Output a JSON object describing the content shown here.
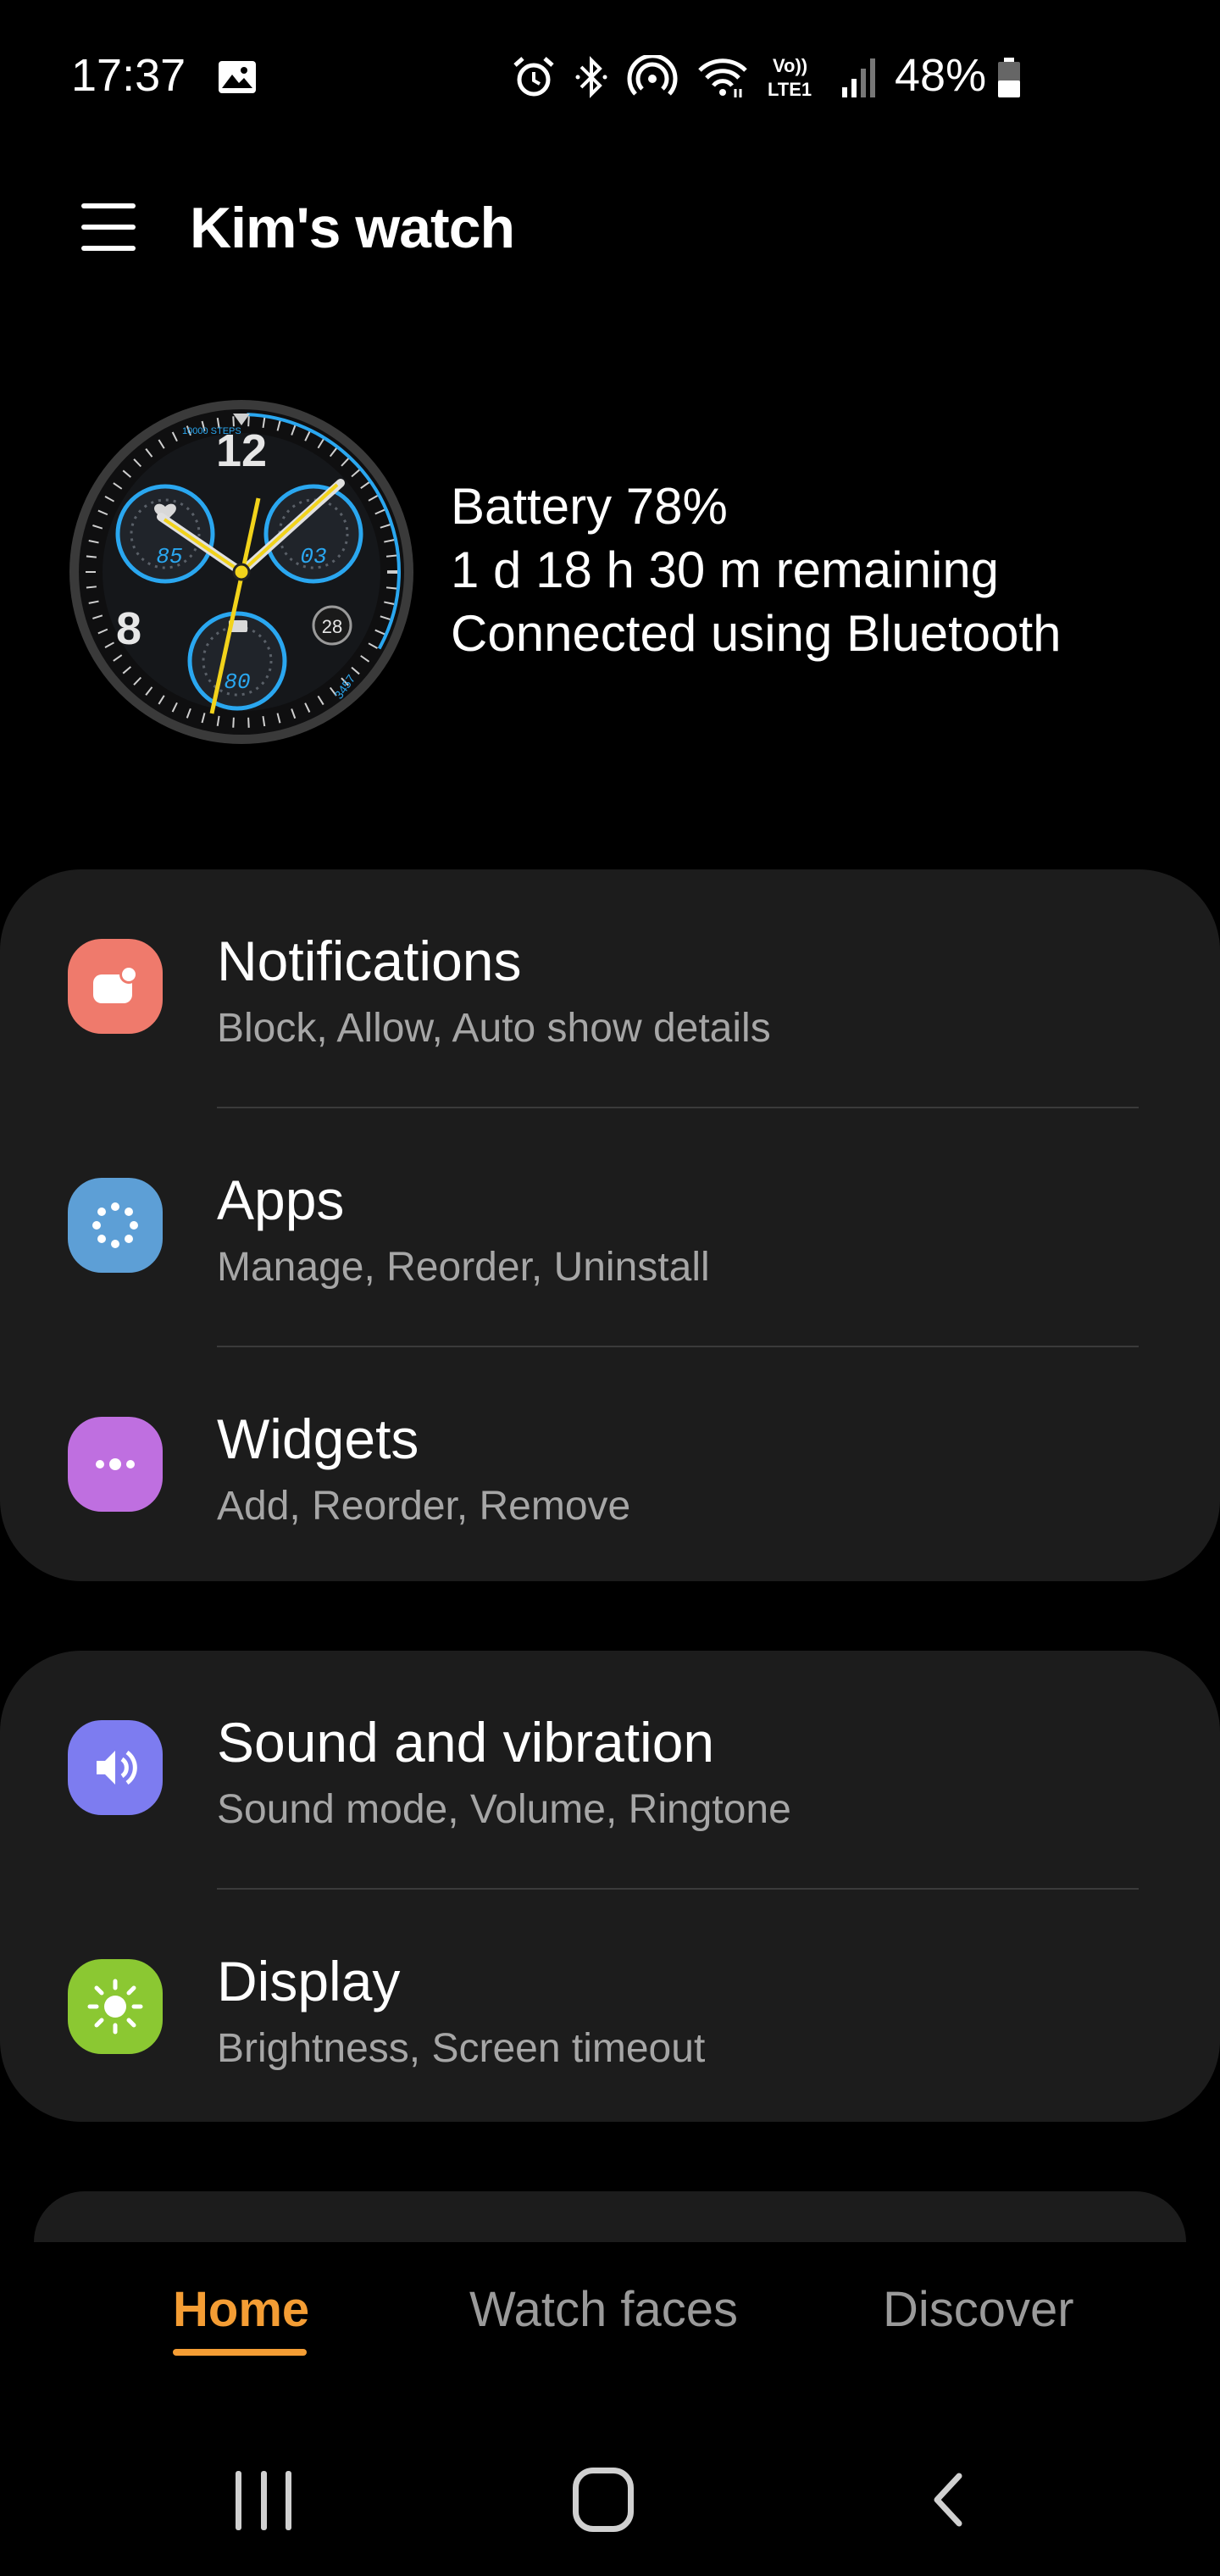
{
  "status_bar": {
    "time": "17:37",
    "battery_percent": "48%",
    "battery_level": 0.48,
    "icons": [
      "gallery-icon",
      "alarm-icon",
      "bluetooth-icon",
      "hotspot-icon",
      "wifi-icon",
      "volte-icon",
      "signal-icon",
      "battery-icon"
    ],
    "volte_label_top": "Vo))",
    "volte_label_bottom": "LTE1"
  },
  "header": {
    "title": "Kim's watch",
    "menu_icon": "hamburger-menu-icon"
  },
  "watch": {
    "face_numbers": {
      "twelve": "12",
      "eight": "8",
      "date": "28"
    },
    "face_steps_label": "10000 STEPS",
    "face_dials": {
      "left": "85",
      "right": "03",
      "bottom": "80"
    },
    "face_steps_count": "3457",
    "battery_line": "Battery 78%",
    "remaining_line": "1 d 18 h 30 m remaining",
    "connection_line": "Connected using Bluetooth"
  },
  "menu_groups": [
    {
      "items": [
        {
          "title": "Notifications",
          "subtitle": "Block, Allow, Auto show details",
          "icon": "notifications-icon",
          "color": "#ef7a6c"
        },
        {
          "title": "Apps",
          "subtitle": "Manage, Reorder, Uninstall",
          "icon": "apps-icon",
          "color": "#5d9fd6"
        },
        {
          "title": "Widgets",
          "subtitle": "Add, Reorder, Remove",
          "icon": "widgets-icon",
          "color": "#bf6fe0"
        }
      ]
    },
    {
      "items": [
        {
          "title": "Sound and vibration",
          "subtitle": "Sound mode, Volume, Ringtone",
          "icon": "sound-icon",
          "color": "#7d7cf0"
        },
        {
          "title": "Display",
          "subtitle": "Brightness, Screen timeout",
          "icon": "display-icon",
          "color": "#8bc832"
        }
      ]
    }
  ],
  "tabs": [
    {
      "label": "Home",
      "active": true
    },
    {
      "label": "Watch faces",
      "active": false
    },
    {
      "label": "Discover",
      "active": false
    }
  ],
  "colors": {
    "accent": "#f49d34",
    "card_bg": "#1c1c1c",
    "subtitle": "#a6a6a6",
    "watch_blue": "#2aa7f0",
    "watch_yellow": "#f2d31b"
  },
  "nav_bar": {
    "buttons": [
      "recents-icon",
      "home-icon",
      "back-icon"
    ]
  }
}
